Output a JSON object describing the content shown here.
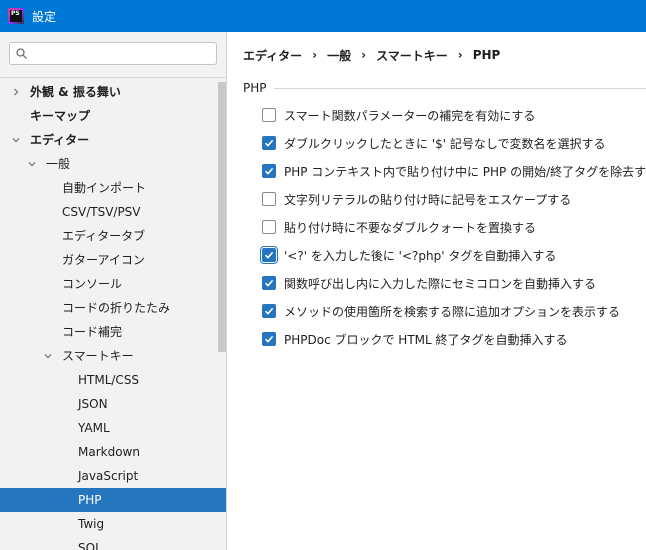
{
  "window": {
    "title": "設定",
    "app_icon_text": "PS"
  },
  "sidebar": {
    "search_placeholder": "",
    "items": [
      {
        "label": "外観 & 振る舞い",
        "bold": true,
        "chevron": "right",
        "level": 0
      },
      {
        "label": "キーマップ",
        "bold": true,
        "chevron": "",
        "level": 0
      },
      {
        "label": "エディター",
        "bold": true,
        "chevron": "down",
        "level": 0
      },
      {
        "label": "一般",
        "bold": false,
        "chevron": "down",
        "level": 1
      },
      {
        "label": "自動インポート",
        "bold": false,
        "chevron": "",
        "level": 2
      },
      {
        "label": "CSV/TSV/PSV",
        "bold": false,
        "chevron": "",
        "level": 2
      },
      {
        "label": "エディタータブ",
        "bold": false,
        "chevron": "",
        "level": 2
      },
      {
        "label": "ガターアイコン",
        "bold": false,
        "chevron": "",
        "level": 2
      },
      {
        "label": "コンソール",
        "bold": false,
        "chevron": "",
        "level": 2
      },
      {
        "label": "コードの折りたたみ",
        "bold": false,
        "chevron": "",
        "level": 2
      },
      {
        "label": "コード補完",
        "bold": false,
        "chevron": "",
        "level": 2
      },
      {
        "label": "スマートキー",
        "bold": false,
        "chevron": "down",
        "level": 2
      },
      {
        "label": "HTML/CSS",
        "bold": false,
        "chevron": "",
        "level": 3
      },
      {
        "label": "JSON",
        "bold": false,
        "chevron": "",
        "level": 3
      },
      {
        "label": "YAML",
        "bold": false,
        "chevron": "",
        "level": 3
      },
      {
        "label": "Markdown",
        "bold": false,
        "chevron": "",
        "level": 3
      },
      {
        "label": "JavaScript",
        "bold": false,
        "chevron": "",
        "level": 3
      },
      {
        "label": "PHP",
        "bold": false,
        "chevron": "",
        "level": 3,
        "selected": true
      },
      {
        "label": "Twig",
        "bold": false,
        "chevron": "",
        "level": 3
      },
      {
        "label": "SQL",
        "bold": false,
        "chevron": "",
        "level": 3
      }
    ]
  },
  "breadcrumb": [
    "エディター",
    "一般",
    "スマートキー",
    "PHP"
  ],
  "breadcrumb_separator": "›",
  "group": {
    "title": "PHP",
    "options": [
      {
        "label": "スマート関数パラメーターの補完を有効にする",
        "checked": false
      },
      {
        "label": "ダブルクリックしたときに '$' 記号なしで変数名を選択する",
        "checked": true
      },
      {
        "label": "PHP コンテキスト内で貼り付け中に PHP の開始/終了タグを除去する",
        "checked": true
      },
      {
        "label": "文字列リテラルの貼り付け時に記号をエスケープする",
        "checked": false
      },
      {
        "label": "貼り付け時に不要なダブルクォートを置換する",
        "checked": false
      },
      {
        "label": "'<?' を入力した後に '<?php' タグを自動挿入する",
        "checked": true,
        "focused": true
      },
      {
        "label": "関数呼び出し内に入力した際にセミコロンを自動挿入する",
        "checked": true
      },
      {
        "label": "メソッドの使用箇所を検索する際に追加オプションを表示する",
        "checked": true
      },
      {
        "label": "PHPDoc ブロックで HTML 終了タグを自動挿入する",
        "checked": true
      }
    ]
  },
  "colors": {
    "titlebar": "#0078d7",
    "selection": "#2675bf",
    "checkbox_checked": "#2675bf"
  }
}
